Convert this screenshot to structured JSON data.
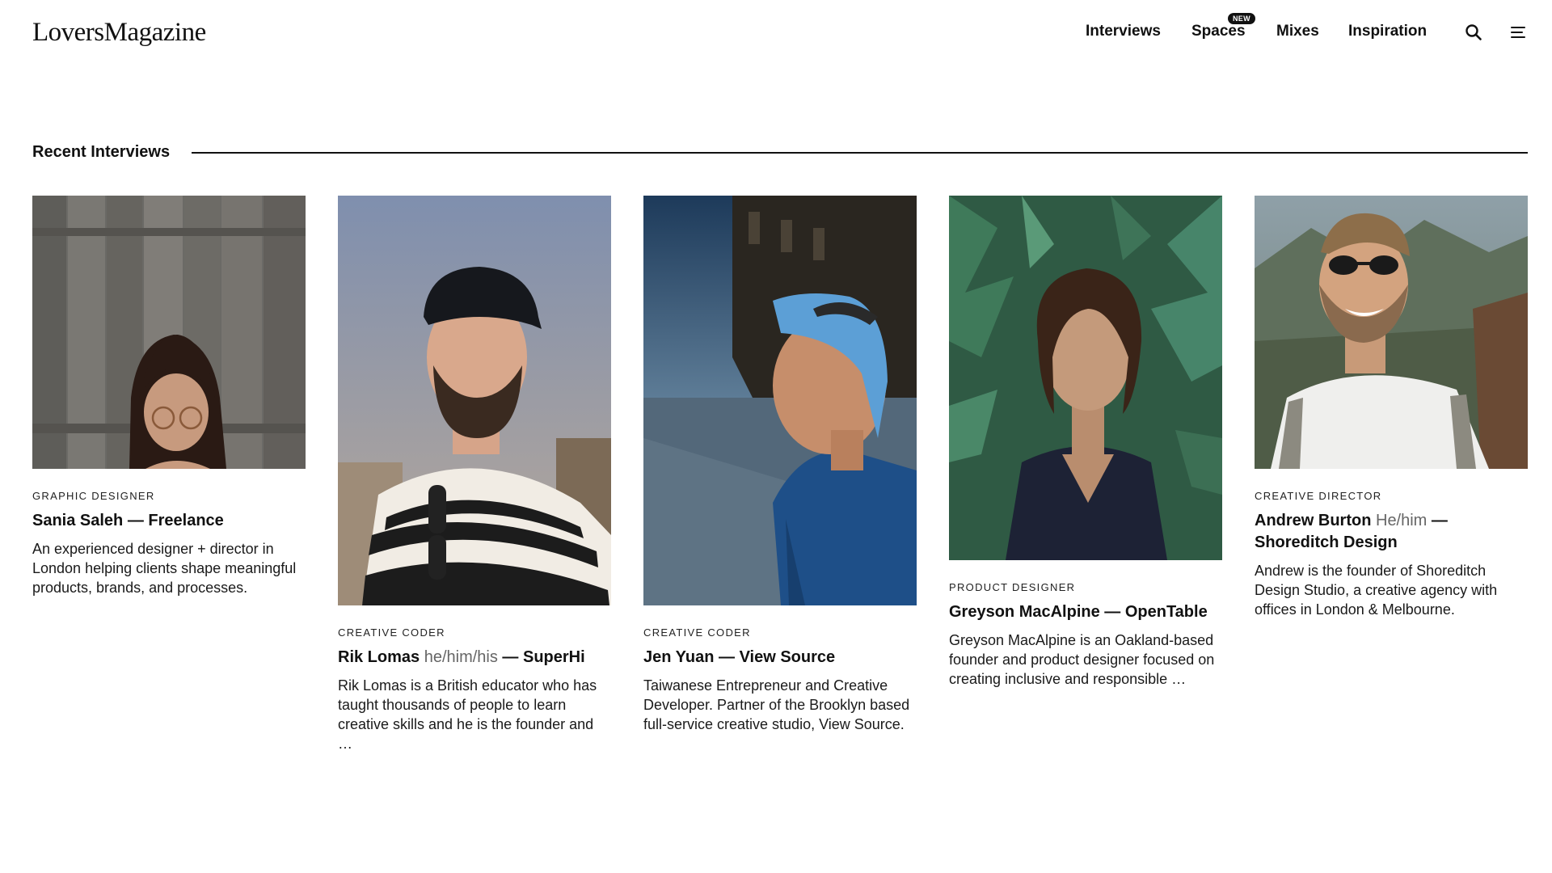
{
  "brand": {
    "logo": "LoversMagazine"
  },
  "nav": {
    "items": [
      {
        "label": "Interviews"
      },
      {
        "label": "Spaces"
      },
      {
        "label": "Mixes"
      },
      {
        "label": "Inspiration"
      }
    ],
    "new_badge": "NEW",
    "icons": [
      "search-icon",
      "menu-icon"
    ]
  },
  "section": {
    "title": "Recent Interviews"
  },
  "cards": [
    {
      "role": "Graphic Designer",
      "name": "Sania Saleh",
      "pronoun": "",
      "org": " — Freelance",
      "desc": "An experienced designer + director in London helping clients shape meaningful products, brands, and processes."
    },
    {
      "role": "Creative Coder",
      "name": "Rik Lomas",
      "pronoun": " he/him/his",
      "org": " — SuperHi",
      "desc": "Rik Lomas is a British educator who has taught thousands of people to learn creative skills and he is the founder and …"
    },
    {
      "role": "Creative Coder",
      "name": "Jen Yuan",
      "pronoun": "",
      "org": " — View Source",
      "desc": "Taiwanese Entrepreneur and Creative Developer. Partner of the Brooklyn based full-service creative studio, View Source."
    },
    {
      "role": "Product Designer",
      "name": "Greyson MacAlpine",
      "pronoun": "",
      "org": " — OpenTable",
      "desc": "Greyson MacAlpine is an Oakland-based founder and product designer focused on creating inclusive and responsible …"
    },
    {
      "role": "Creative Director",
      "name": "Andrew Burton",
      "pronoun": " He/him",
      "org": " — Shoreditch Design",
      "desc": "Andrew is the founder of Shoreditch Design Studio, a creative agency with offices in London & Melbourne."
    }
  ],
  "colors": {
    "text": "#111111",
    "muted": "#666666",
    "background": "#ffffff"
  }
}
